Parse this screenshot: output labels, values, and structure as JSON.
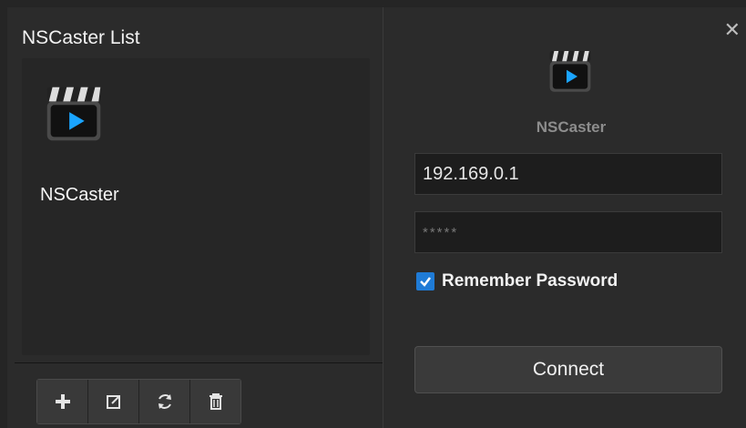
{
  "left_panel": {
    "title": "NSCaster List",
    "devices": [
      {
        "name": "NSCaster",
        "icon": "clapperboard-icon"
      }
    ],
    "toolbar": [
      {
        "name": "add",
        "icon": "plus-icon"
      },
      {
        "name": "edit",
        "icon": "edit-icon"
      },
      {
        "name": "refresh",
        "icon": "refresh-icon"
      },
      {
        "name": "delete",
        "icon": "trash-icon"
      }
    ]
  },
  "right_panel": {
    "close_icon": "close-icon",
    "app_icon": "clapperboard-icon",
    "app_name": "NSCaster",
    "ip_value": "192.169.0.1",
    "password_value": "*****",
    "remember_label": "Remember Password",
    "remember_checked": true,
    "connect_label": "Connect"
  },
  "colors": {
    "accent_blue": "#1f7bd6",
    "panel_bg": "#2b2b2b",
    "input_bg": "#1d1d1d"
  }
}
